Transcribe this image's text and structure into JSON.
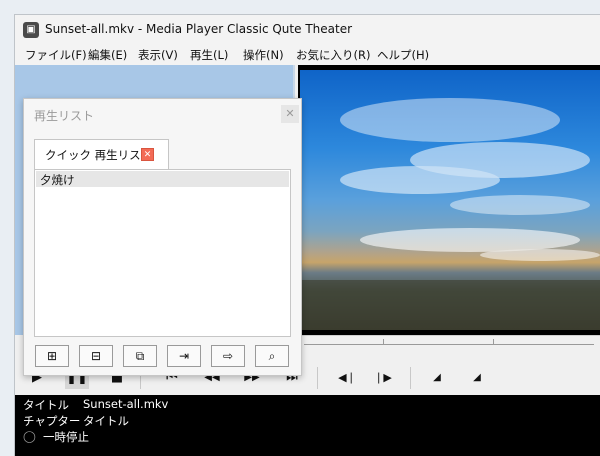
{
  "window": {
    "title": "Sunset-all.mkv - Media Player Classic Qute Theater",
    "app_icon": "film-icon"
  },
  "menu": [
    {
      "label": "ファイル(F)"
    },
    {
      "label": "編集(E)"
    },
    {
      "label": "表示(V)"
    },
    {
      "label": "再生(L)"
    },
    {
      "label": "操作(N)"
    },
    {
      "label": "お気に入り(R)"
    },
    {
      "label": "ヘルプ(H)"
    }
  ],
  "playlist_dialog": {
    "title": "再生リスト",
    "close_icon": "close-icon",
    "tab_label": "クイック 再生リスト",
    "tab_close_icon": "close-icon",
    "items": [
      {
        "label": "夕焼け"
      }
    ],
    "buttons": [
      {
        "icon": "add-icon",
        "glyph": "⊞"
      },
      {
        "icon": "remove-icon",
        "glyph": "⊟"
      },
      {
        "icon": "duplicate-icon",
        "glyph": "⧉"
      },
      {
        "icon": "import-icon",
        "glyph": "⇥"
      },
      {
        "icon": "export-icon",
        "glyph": "⇨"
      },
      {
        "icon": "search-list-icon",
        "glyph": "⌕"
      }
    ]
  },
  "controls": [
    {
      "icon": "play-icon",
      "glyph": "▶"
    },
    {
      "icon": "pause-icon",
      "glyph": "❚❚"
    },
    {
      "icon": "stop-icon",
      "glyph": "■"
    },
    {
      "icon": "skip-back-icon",
      "glyph": "⏮"
    },
    {
      "icon": "rewind-icon",
      "glyph": "◀◀"
    },
    {
      "icon": "fast-forward-icon",
      "glyph": "▶▶"
    },
    {
      "icon": "skip-forward-icon",
      "glyph": "⏭"
    },
    {
      "icon": "frame-back-icon",
      "glyph": "◀❘"
    },
    {
      "icon": "frame-forward-icon",
      "glyph": "❘▶"
    },
    {
      "icon": "volume-down-icon",
      "glyph": "◢"
    },
    {
      "icon": "volume-up-icon",
      "glyph": "◢"
    }
  ],
  "status": {
    "title_label": "タイトル",
    "title_value": "Sunset-all.mkv",
    "chapter_label": "チャプター",
    "chapter_value": "タイトル",
    "state_icon": "paused-status-icon",
    "state_text": "一時停止"
  },
  "colors": {
    "video_sky": "#2d88dc",
    "tab_close": "#f36b56",
    "status_bg": "#000000"
  }
}
